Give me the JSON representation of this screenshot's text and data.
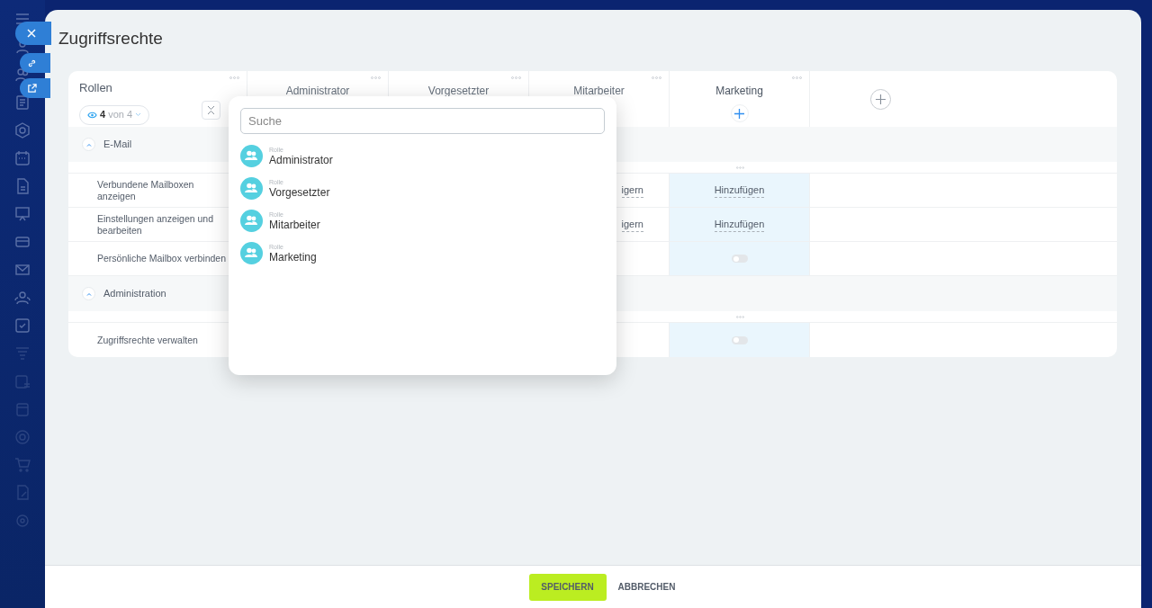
{
  "window": {
    "title": "Zugriffsrechte"
  },
  "roles_header": {
    "label": "Rollen",
    "count": "4",
    "of": "von 4"
  },
  "columns": [
    {
      "name": "Administrator",
      "selected": false
    },
    {
      "name": "Vorgesetzter",
      "selected": false
    },
    {
      "name": "Mitarbeiter",
      "selected": false
    },
    {
      "name": "Marketing",
      "selected": true
    }
  ],
  "sections": [
    {
      "title": "E-Mail",
      "expanded": true,
      "rows": [
        {
          "label": "Verbundene Mailboxen anzeigen",
          "cells": [
            null,
            null,
            {
              "kind": "link",
              "text": "igern"
            },
            {
              "kind": "link",
              "text": "Hinzufügen"
            }
          ]
        },
        {
          "label": "Einstellungen anzeigen und bearbeiten",
          "cells": [
            null,
            null,
            {
              "kind": "link",
              "text": "igern"
            },
            {
              "kind": "link",
              "text": "Hinzufügen"
            }
          ]
        },
        {
          "label": "Persönliche Mailbox verbinden",
          "cells": [
            null,
            null,
            null,
            {
              "kind": "toggle",
              "on": false
            }
          ]
        }
      ]
    },
    {
      "title": "Administration",
      "expanded": true,
      "rows": [
        {
          "label": "Zugriffsrechte verwalten",
          "cells": [
            null,
            null,
            null,
            {
              "kind": "toggle",
              "on": false
            }
          ]
        }
      ]
    }
  ],
  "popup": {
    "placeholder": "Suche",
    "items": [
      {
        "caption": "Rolle",
        "name": "Administrator"
      },
      {
        "caption": "Rolle",
        "name": "Vorgesetzter"
      },
      {
        "caption": "Rolle",
        "name": "Mitarbeiter"
      },
      {
        "caption": "Rolle",
        "name": "Marketing"
      }
    ]
  },
  "footer": {
    "save": "SPEICHERN",
    "cancel": "ABBRECHEN"
  }
}
